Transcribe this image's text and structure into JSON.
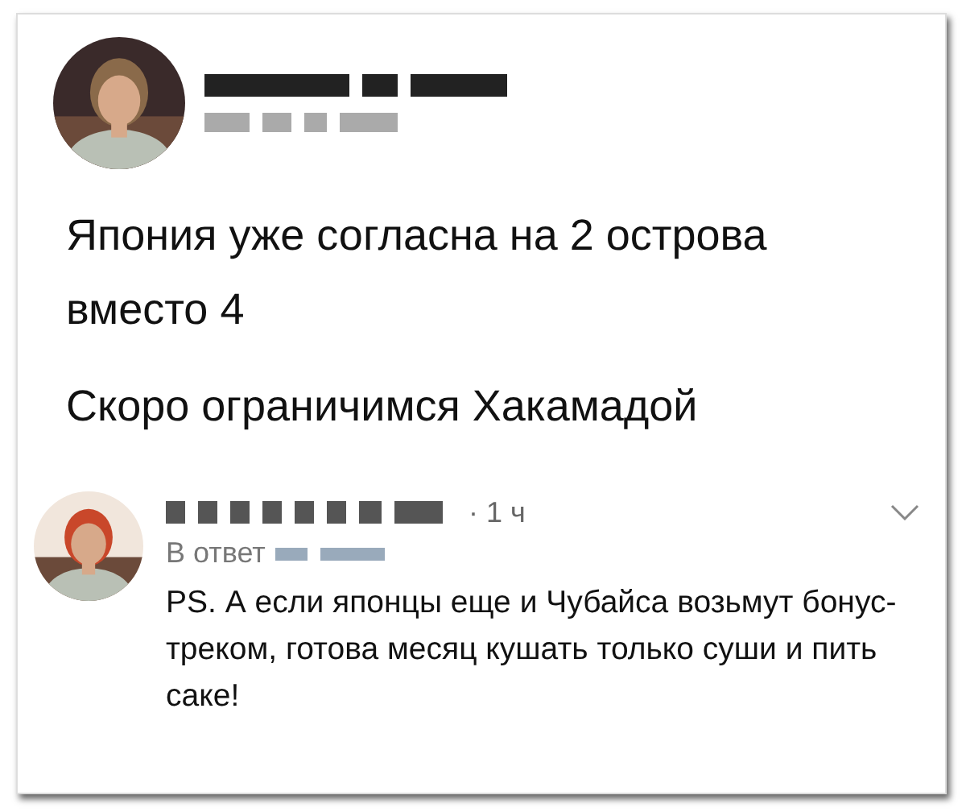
{
  "tweet": {
    "paragraphs": [
      "Япония уже согласна на 2 острова вместо 4",
      "Скоро ограничимся Хакамадой"
    ]
  },
  "reply": {
    "time": "· 1 ч",
    "reply_to_label": "В ответ",
    "text": "PS. А если японцы еще и Чубайса возьмут бонус-треком, готова месяц кушать только суши и пить саке!"
  }
}
